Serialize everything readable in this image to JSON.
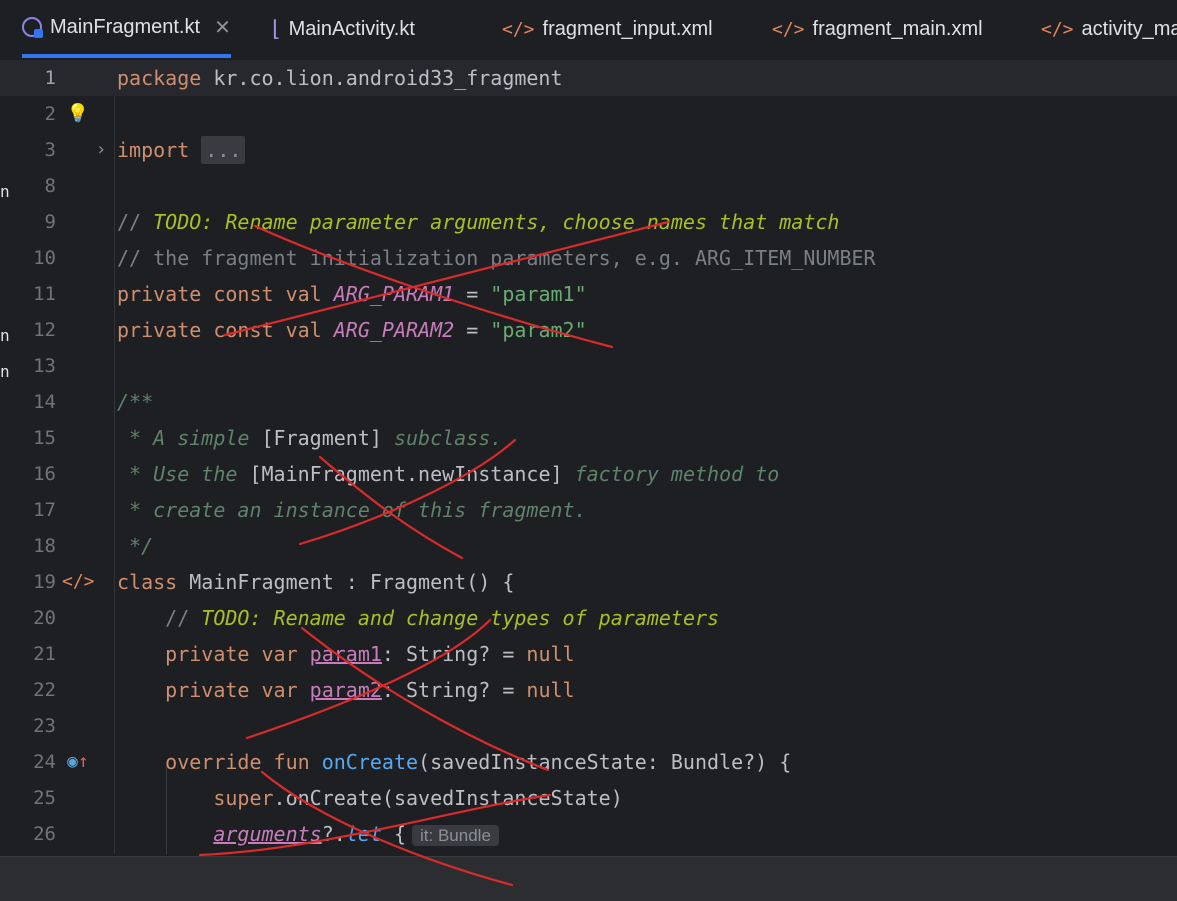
{
  "tabs": [
    {
      "label": "MainFragment.kt",
      "icon": "kotlin-file-icon",
      "active": true,
      "close": "✕"
    },
    {
      "label": "MainActivity.kt",
      "icon": "kotlin-activity-icon",
      "active": false
    },
    {
      "label": "fragment_input.xml",
      "icon": "xml-file-icon",
      "active": false
    },
    {
      "label": "fragment_main.xml",
      "icon": "xml-file-icon",
      "active": false
    },
    {
      "label": "activity_ma",
      "icon": "xml-file-icon",
      "active": false
    }
  ],
  "gutter": {
    "icons": [
      "lightbulb-icon",
      "fold-chevron-icon",
      "xml-link-icon",
      "override-icon"
    ]
  },
  "lines": [
    {
      "n": "1",
      "tokens": [
        [
          "kw",
          "package "
        ],
        [
          "",
          "kr.co.lion.android33_fragment"
        ]
      ]
    },
    {
      "n": "2",
      "tokens": []
    },
    {
      "n": "3",
      "tokens": [
        [
          "kw",
          "import "
        ],
        [
          "fold",
          "..."
        ]
      ]
    },
    {
      "n": "8",
      "tokens": []
    },
    {
      "n": "9",
      "tokens": [
        [
          "cmt",
          "// "
        ],
        [
          "todo",
          "TODO: Rename parameter arguments, choose names that match"
        ]
      ]
    },
    {
      "n": "10",
      "tokens": [
        [
          "cmt",
          "// the fragment initialization parameters, e.g. ARG_ITEM_NUMBER"
        ]
      ]
    },
    {
      "n": "11",
      "tokens": [
        [
          "kw",
          "private const val "
        ],
        [
          "constv",
          "ARG_PARAM1"
        ],
        [
          "",
          " = "
        ],
        [
          "str",
          "\"param1\""
        ]
      ]
    },
    {
      "n": "12",
      "tokens": [
        [
          "kw",
          "private const val "
        ],
        [
          "constv",
          "ARG_PARAM2"
        ],
        [
          "",
          " = "
        ],
        [
          "str",
          "\"param2\""
        ]
      ]
    },
    {
      "n": "13",
      "tokens": []
    },
    {
      "n": "14",
      "tokens": [
        [
          "doc",
          "/**"
        ]
      ]
    },
    {
      "n": "15",
      "tokens": [
        [
          "doc",
          " * A simple "
        ],
        [
          "docref",
          "[Fragment]"
        ],
        [
          "doc",
          " subclass."
        ]
      ]
    },
    {
      "n": "16",
      "tokens": [
        [
          "doc",
          " * Use the "
        ],
        [
          "docref",
          "[MainFragment.newInstance]"
        ],
        [
          "doc",
          " factory method to"
        ]
      ]
    },
    {
      "n": "17",
      "tokens": [
        [
          "doc",
          " * create an instance of this fragment."
        ]
      ]
    },
    {
      "n": "18",
      "tokens": [
        [
          "doc",
          " */"
        ]
      ]
    },
    {
      "n": "19",
      "tokens": [
        [
          "kw",
          "class "
        ],
        [
          "",
          "MainFragment : Fragment() {"
        ]
      ]
    },
    {
      "n": "20",
      "tokens": [
        [
          "cmt",
          "    // "
        ],
        [
          "todo",
          "TODO: Rename and change types of parameters"
        ]
      ]
    },
    {
      "n": "21",
      "tokens": [
        [
          "kw",
          "    private var "
        ],
        [
          "prop",
          "param1"
        ],
        [
          "",
          ": String? = "
        ],
        [
          "kw",
          "null"
        ]
      ]
    },
    {
      "n": "22",
      "tokens": [
        [
          "kw",
          "    private var "
        ],
        [
          "prop",
          "param2"
        ],
        [
          "",
          ": String? = "
        ],
        [
          "kw",
          "null"
        ]
      ]
    },
    {
      "n": "23",
      "tokens": []
    },
    {
      "n": "24",
      "tokens": [
        [
          "kw",
          "    override fun "
        ],
        [
          "fn",
          "onCreate"
        ],
        [
          "",
          "(savedInstanceState: Bundle?) {"
        ]
      ]
    },
    {
      "n": "25",
      "tokens": [
        [
          "kw",
          "        super"
        ],
        [
          "",
          ".onCreate(savedInstanceState)"
        ]
      ]
    },
    {
      "n": "26",
      "tokens": [
        [
          "",
          "        "
        ],
        [
          "argu",
          "arguments"
        ],
        [
          "",
          "?."
        ],
        [
          "letfn",
          "let"
        ],
        [
          "",
          " {"
        ],
        [
          "hint",
          "it: Bundle"
        ]
      ]
    }
  ],
  "colors": {
    "background": "#1e1f22",
    "keyword": "#cf8e6d",
    "string": "#6aab73",
    "comment": "#7a7e85",
    "todo": "#a8c023",
    "function": "#56a8f5",
    "scribble": "#d92b2b"
  }
}
